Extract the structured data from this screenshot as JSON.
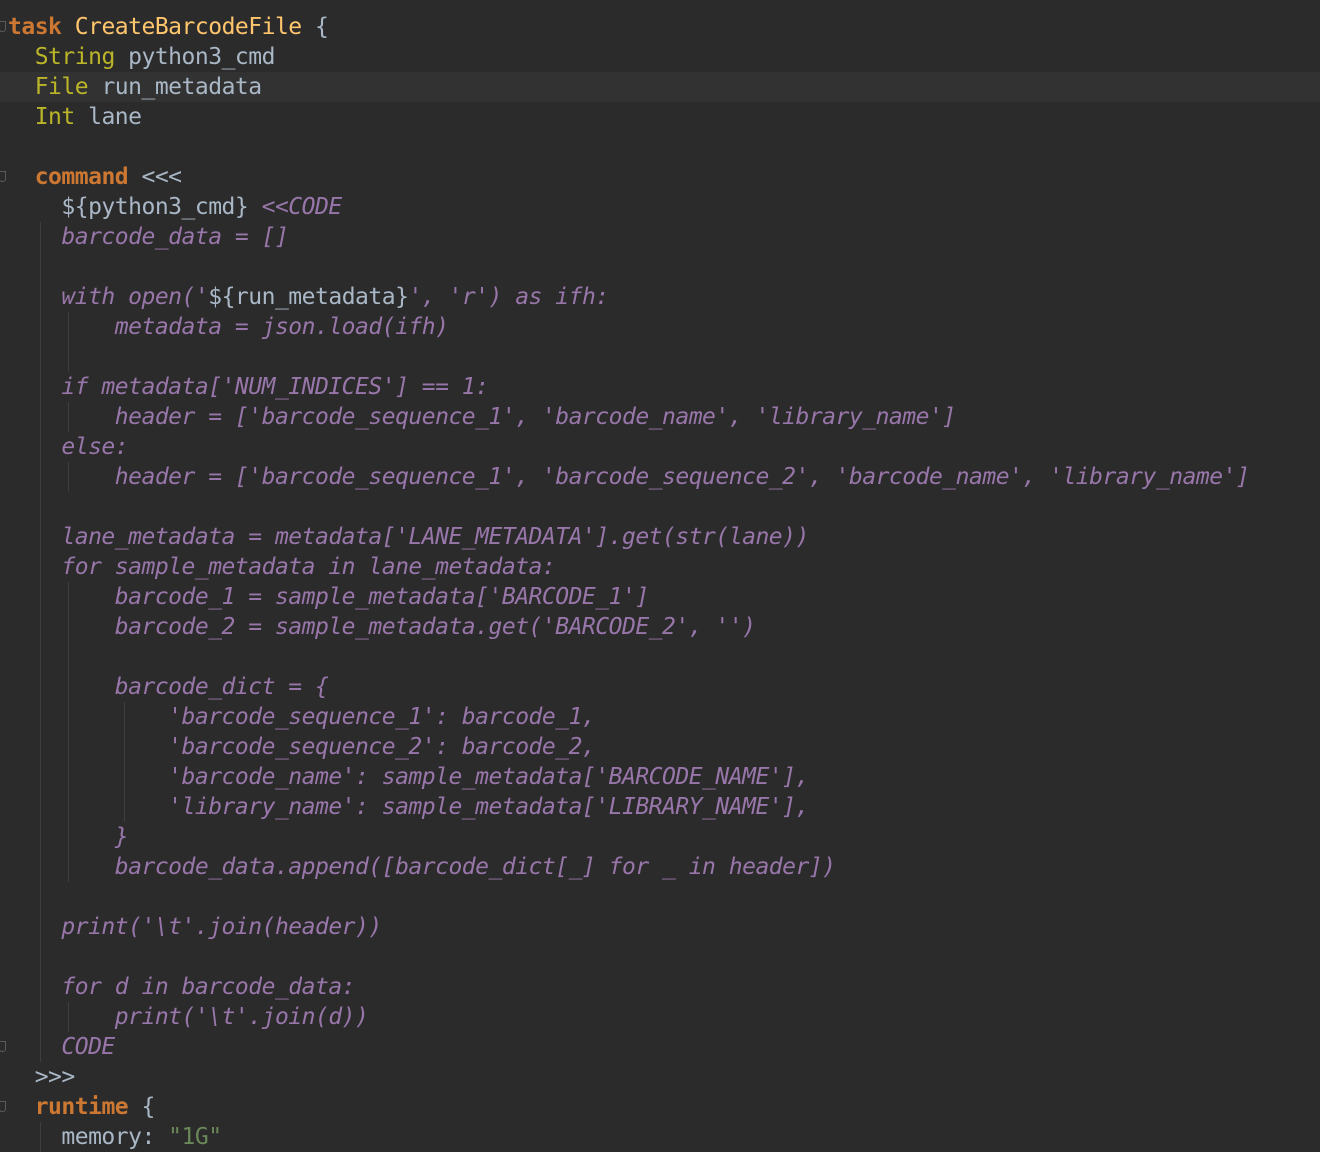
{
  "editor": {
    "colors": {
      "background": "#2b2b2b",
      "current_line": "#323232",
      "keyword": "#cc7832",
      "type": "#bbb529",
      "task_name": "#ffc66d",
      "identifier": "#a9b7c6",
      "embedded_code": "#9876aa",
      "string": "#6a8759"
    },
    "lines": [
      [
        {
          "t": "task",
          "c": "kw"
        },
        {
          "t": " ",
          "c": "plain"
        },
        {
          "t": "CreateBarcodeFile",
          "c": "name"
        },
        {
          "t": " {",
          "c": "plain"
        }
      ],
      [
        {
          "t": "  ",
          "c": "plain"
        },
        {
          "t": "String",
          "c": "type"
        },
        {
          "t": " python3_cmd",
          "c": "plain"
        }
      ],
      [
        {
          "t": "  ",
          "c": "plain"
        },
        {
          "t": "File",
          "c": "type"
        },
        {
          "t": " run_metadata",
          "c": "plain"
        }
      ],
      [
        {
          "t": "  ",
          "c": "plain"
        },
        {
          "t": "Int",
          "c": "type"
        },
        {
          "t": " lane",
          "c": "plain"
        }
      ],
      [],
      [
        {
          "t": "  ",
          "c": "plain"
        },
        {
          "t": "command",
          "c": "kw"
        },
        {
          "t": " <<<",
          "c": "plain"
        }
      ],
      [
        {
          "t": "    ",
          "c": "plain"
        },
        {
          "t": "${python3_cmd}",
          "c": "interp"
        },
        {
          "t": " <<CODE",
          "c": "embed"
        }
      ],
      [
        {
          "t": "    barcode_data = []",
          "c": "embed"
        }
      ],
      [],
      [
        {
          "t": "    with open('",
          "c": "embed"
        },
        {
          "t": "${run_metadata}",
          "c": "interp"
        },
        {
          "t": "', 'r') as ifh:",
          "c": "embed"
        }
      ],
      [
        {
          "t": "        metadata = json.load(ifh)",
          "c": "embed"
        }
      ],
      [],
      [
        {
          "t": "    if metadata['NUM_INDICES'] == 1:",
          "c": "embed"
        }
      ],
      [
        {
          "t": "        header = ['barcode_sequence_1', 'barcode_name', 'library_name']",
          "c": "embed"
        }
      ],
      [
        {
          "t": "    else:",
          "c": "embed"
        }
      ],
      [
        {
          "t": "        header = ['barcode_sequence_1', 'barcode_sequence_2', 'barcode_name', 'library_name']",
          "c": "embed"
        }
      ],
      [],
      [
        {
          "t": "    lane_metadata = metadata['LANE_METADATA'].get(str(lane))",
          "c": "embed"
        }
      ],
      [
        {
          "t": "    for sample_metadata in lane_metadata:",
          "c": "embed"
        }
      ],
      [
        {
          "t": "        barcode_1 = sample_metadata['BARCODE_1']",
          "c": "embed"
        }
      ],
      [
        {
          "t": "        barcode_2 = sample_metadata.get('BARCODE_2', '')",
          "c": "embed"
        }
      ],
      [],
      [
        {
          "t": "        barcode_dict = {",
          "c": "embed"
        }
      ],
      [
        {
          "t": "            'barcode_sequence_1': barcode_1,",
          "c": "embed"
        }
      ],
      [
        {
          "t": "            'barcode_sequence_2': barcode_2,",
          "c": "embed"
        }
      ],
      [
        {
          "t": "            'barcode_name': sample_metadata['BARCODE_NAME'],",
          "c": "embed"
        }
      ],
      [
        {
          "t": "            'library_name': sample_metadata['LIBRARY_NAME'],",
          "c": "embed"
        }
      ],
      [
        {
          "t": "        }",
          "c": "embed"
        }
      ],
      [
        {
          "t": "        barcode_data.append([barcode_dict[_] for _ in header])",
          "c": "embed"
        }
      ],
      [],
      [
        {
          "t": "    print('\\t'.join(header))",
          "c": "embed"
        }
      ],
      [],
      [
        {
          "t": "    for d in barcode_data:",
          "c": "embed"
        }
      ],
      [
        {
          "t": "        print('\\t'.join(d))",
          "c": "embed"
        }
      ],
      [
        {
          "t": "    CODE",
          "c": "embed"
        }
      ],
      [
        {
          "t": "  >>>",
          "c": "plain"
        }
      ],
      [
        {
          "t": "  ",
          "c": "plain"
        },
        {
          "t": "runtime",
          "c": "kw"
        },
        {
          "t": " {",
          "c": "plain"
        }
      ],
      [
        {
          "t": "    memory: ",
          "c": "plain"
        },
        {
          "t": "\"1G\"",
          "c": "str"
        }
      ]
    ]
  }
}
